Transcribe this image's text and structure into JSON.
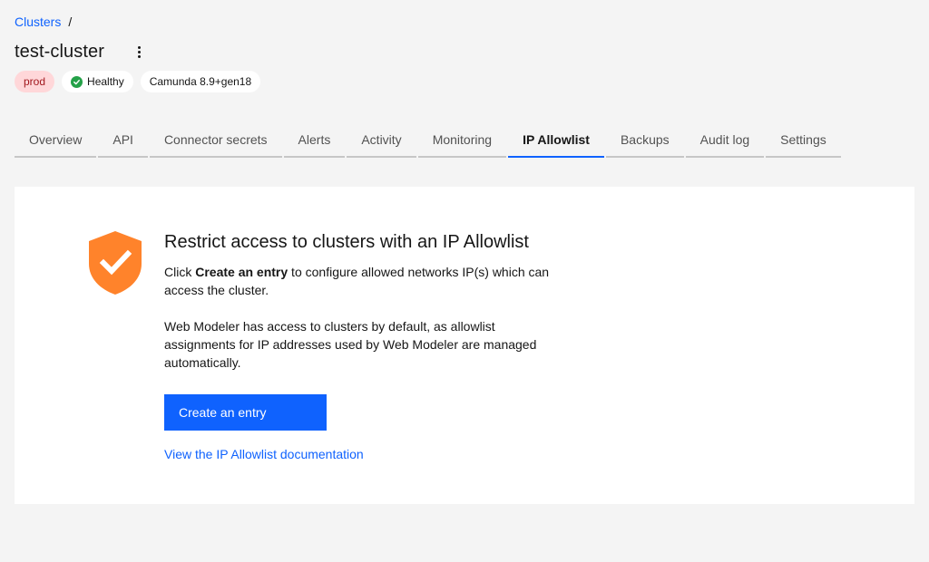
{
  "breadcrumb": {
    "root": "Clusters",
    "separator": "/"
  },
  "cluster": {
    "name": "test-cluster"
  },
  "tags": {
    "env": "prod",
    "health": "Healthy",
    "version": "Camunda 8.9+gen18"
  },
  "tabs": [
    {
      "label": "Overview"
    },
    {
      "label": "API"
    },
    {
      "label": "Connector secrets"
    },
    {
      "label": "Alerts"
    },
    {
      "label": "Activity"
    },
    {
      "label": "Monitoring"
    },
    {
      "label": "IP Allowlist",
      "active": true
    },
    {
      "label": "Backups"
    },
    {
      "label": "Audit log"
    },
    {
      "label": "Settings"
    }
  ],
  "empty_state": {
    "icon": "shield-check-icon",
    "heading": "Restrict access to clusters with an IP Allowlist",
    "para1_prefix": "Click ",
    "para1_bold": "Create an entry",
    "para1_suffix": " to configure allowed networks IP(s) which can access the cluster.",
    "para2": "Web Modeler has access to clusters by default, as allowlist assignments for IP addresses used by Web Modeler are managed automatically.",
    "button": "Create an entry",
    "link": "View the IP Allowlist documentation"
  },
  "colors": {
    "accent": "#0f62fe",
    "shield": "#ff832b",
    "healthy": "#24a148",
    "prod_bg": "#ffd7d9",
    "prod_text": "#a2191f"
  }
}
